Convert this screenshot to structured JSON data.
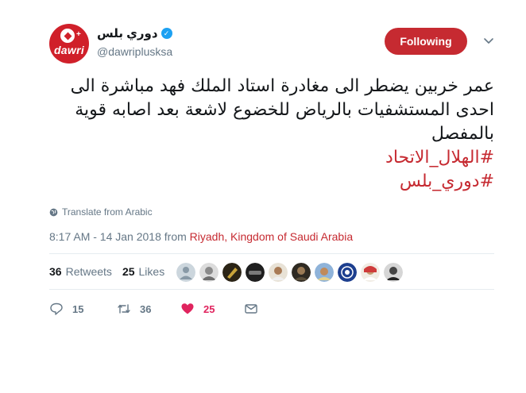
{
  "user": {
    "display_name": "دوري بلس",
    "handle": "@dawriplusksa",
    "avatar_text": "dawri",
    "verified": true
  },
  "follow_button": {
    "label": "Following"
  },
  "tweet": {
    "lines": [
      "عمر خربين يضطر الى مغادرة استاد الملك فهد مباشرة الى",
      "احدى المستشفيات بالرياض للخضوع لاشعة بعد اصابه قوية",
      "بالمفصل"
    ],
    "hashtags": [
      "#الهلال_الاتحاد",
      "#دوري_بلس"
    ]
  },
  "translate": {
    "label": "Translate from Arabic"
  },
  "meta": {
    "timestamp": "8:17 AM - 14 Jan 2018 from ",
    "location": "Riyadh, Kingdom of Saudi Arabia"
  },
  "stats": {
    "retweets_count": "36",
    "retweets_label": "Retweets",
    "likes_count": "25",
    "likes_label": "Likes"
  },
  "likers": [
    {
      "icon": "default-avatar",
      "color": "#ccd6dd"
    },
    {
      "icon": "portrait-avatar",
      "color": "#9b9b9b"
    },
    {
      "icon": "portrait-avatar",
      "color": "#6b5a2a"
    },
    {
      "icon": "portrait-avatar",
      "color": "#2a2a2a"
    },
    {
      "icon": "portrait-avatar",
      "color": "#b08a6a"
    },
    {
      "icon": "portrait-avatar",
      "color": "#3d3528"
    },
    {
      "icon": "portrait-avatar",
      "color": "#7a9fcc"
    },
    {
      "icon": "portrait-avatar",
      "color": "#1d3f8f"
    },
    {
      "icon": "portrait-avatar",
      "color": "#c9a27a"
    },
    {
      "icon": "portrait-avatar",
      "color": "#555555"
    }
  ],
  "actions": {
    "reply_count": "15",
    "retweet_count": "36",
    "like_count": "25"
  },
  "colors": {
    "accent": "#c62a31",
    "muted": "#657786",
    "like": "#e0245e",
    "verified": "#1da1f2"
  }
}
